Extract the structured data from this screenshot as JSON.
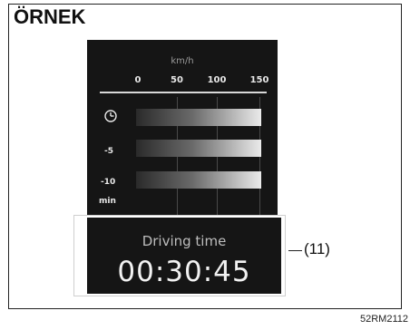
{
  "heading": "ÖRNEK",
  "display": {
    "unit": "km/h",
    "scale": [
      "0",
      "50",
      "100",
      "150"
    ],
    "rows": [
      "-5",
      "-10"
    ],
    "row_unit": "min",
    "clock_icon": "clock-icon"
  },
  "driving": {
    "label": "Driving time",
    "value": "00:30:45"
  },
  "callout": "(11)",
  "figure_code": "52RM2112"
}
